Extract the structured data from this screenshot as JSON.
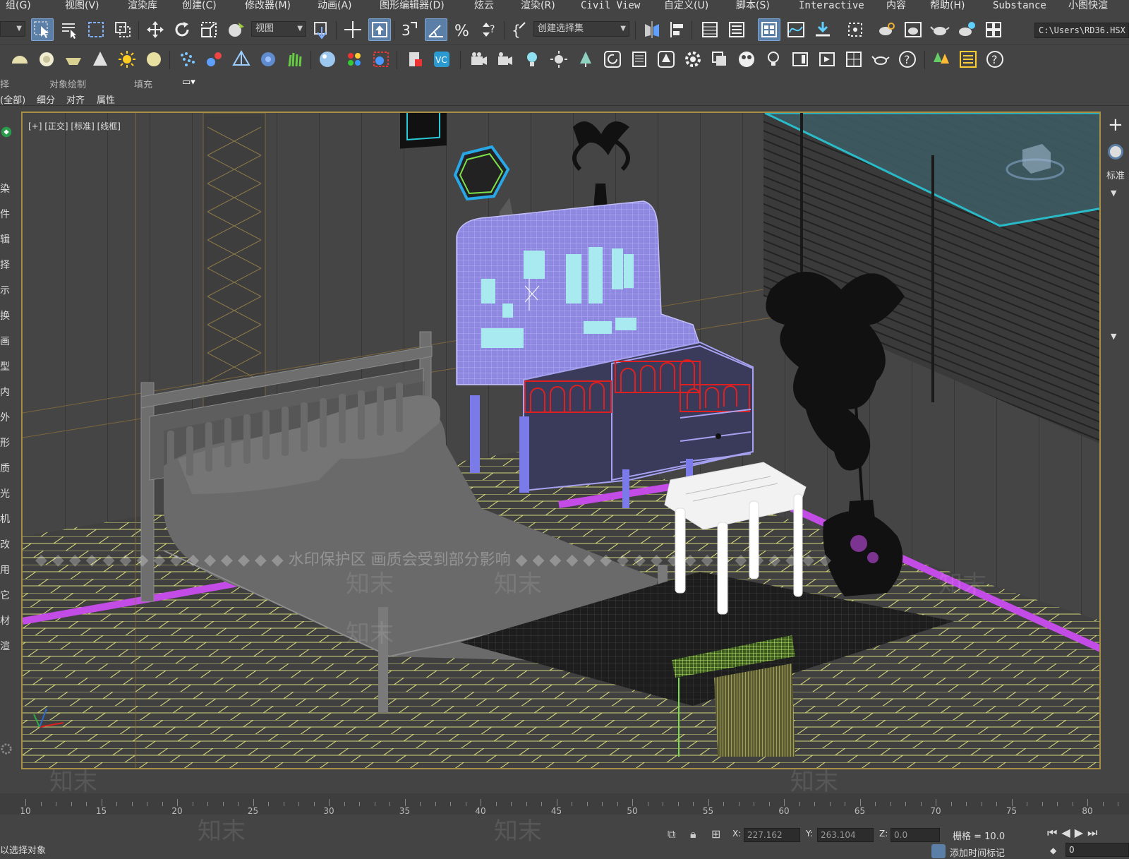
{
  "menubar": {
    "items": [
      "组(G)",
      "视图(V)",
      "渲染库",
      "创建(C)",
      "修改器(M)",
      "动画(A)",
      "图形编辑器(D)",
      "炫云",
      "渲染(R)",
      "Civil View",
      "自定义(U)",
      "脚本(S)",
      "Interactive",
      "内容",
      "帮助(H)",
      "Substance",
      "小图快渲"
    ]
  },
  "toolbar1": {
    "view_dropdown": "视图",
    "selection_set_dropdown": "创建选择集",
    "path": "C:\\Users\\RD36.HSX"
  },
  "ribbon": {
    "labels": [
      "择",
      "对象绘制",
      "填充"
    ],
    "tabs": [
      "(全部)",
      "细分",
      "对齐",
      "属性"
    ]
  },
  "left_panel": {
    "chars": [
      "染",
      "件",
      "辑",
      "择",
      "示",
      "换",
      "画",
      "型",
      "内",
      "外",
      "形",
      "质",
      "光",
      "机",
      "改",
      "用",
      "它",
      "材",
      "渲"
    ]
  },
  "viewport": {
    "label": "[+] [正交] [标准] [线框]"
  },
  "right_panel": {
    "text": "标准"
  },
  "timeline": {
    "ticks": [
      "10",
      "15",
      "20",
      "25",
      "30",
      "35",
      "40",
      "45",
      "50",
      "55",
      "60",
      "65",
      "70",
      "75",
      "80"
    ]
  },
  "status": {
    "left_text": "以选择对象",
    "x_label": "X:",
    "x_value": "227.162",
    "y_label": "Y:",
    "y_value": "263.104",
    "z_label": "Z:",
    "z_value": "0.0",
    "grid": "栅格 = 10.0",
    "add_time_tag": "添加时间标记",
    "frame_value": "0"
  },
  "watermark": {
    "banner": "◆ ◆ ◆ ◆ ◆ ◆ ◆ ◆ ◆ ◆ ◆ ◆ ◆ ◆ ◆ 水印保护区 画质会受到部分影响 ◆ ◆ ◆ ◆ ◆ ◆ ◆ ◆ ◆ ◆ ◆ ◆ ◆ ◆ ◆ ◆ ◆ ◆ ◆",
    "brand": "知末"
  },
  "colors": {
    "ui_bg": "#444444",
    "active_button": "#5c7fa8",
    "viewport_border": "#a89042",
    "floor_grid": "#d6d77a",
    "cabinet_wire": "#9d97e6",
    "accent_red": "#e02020",
    "accent_magenta": "#c44ce6",
    "accent_cyan": "#29c9d8",
    "accent_green": "#7de04a"
  }
}
